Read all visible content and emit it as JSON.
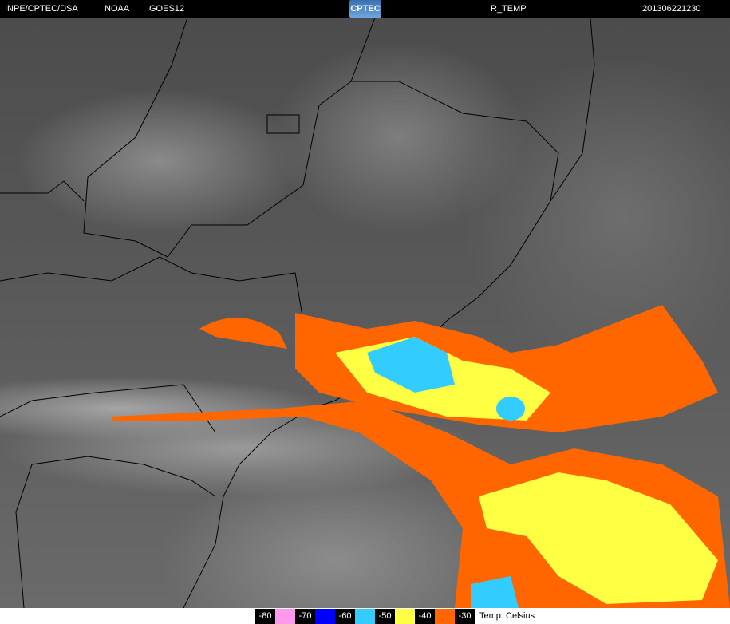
{
  "header": {
    "source": "INPE/CPTEC/DSA",
    "agency": "NOAA",
    "satellite": "GOES12",
    "logo": "CPTEC",
    "product": "R_TEMP",
    "datetime": "201306221230"
  },
  "legend": {
    "items": [
      {
        "label": "-80",
        "color": "#ff99ee"
      },
      {
        "label": "-70",
        "color": "#0000ff"
      },
      {
        "label": "-60",
        "color": "#33ccff"
      },
      {
        "label": "-50",
        "color": "#ffff44"
      },
      {
        "label": "-40",
        "color": "#ff6600"
      },
      {
        "label": "-30",
        "color": null
      }
    ],
    "unit": "Temp. Celsius"
  }
}
